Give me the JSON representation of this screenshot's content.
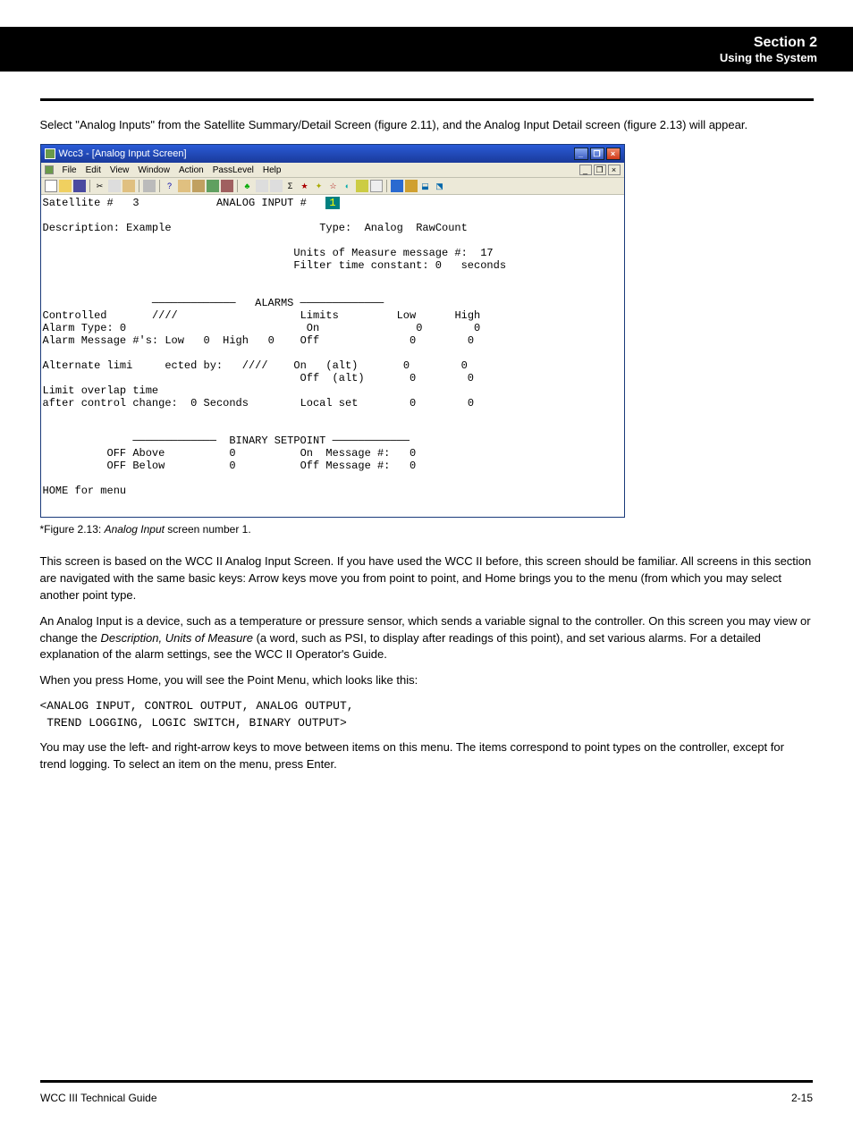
{
  "header": {
    "section_title": "Section 2",
    "section_subtitle": "Using the System"
  },
  "intro": "Select \"Analog Inputs\" from the Satellite Summary/Detail Screen (figure 2.11), and the Analog Input Detail screen (figure 2.13) will appear.",
  "window": {
    "title": "Wcc3 - [Analog Input Screen]",
    "menu": [
      "File",
      "Edit",
      "View",
      "Window",
      "Action",
      "PassLevel",
      "Help"
    ],
    "mdi_controls": {
      "min": "_",
      "restore": "❐",
      "close": "×"
    },
    "win_controls": {
      "min": "_",
      "max": "❐",
      "close": "×"
    },
    "client": {
      "satellite_label": "Satellite #",
      "satellite_num": "3",
      "analog_input_label": "ANALOG INPUT #",
      "analog_input_num": "1",
      "description_label": "Description:",
      "description_value": "Example",
      "type_label": "Type:",
      "type_value": "Analog  RawCount",
      "units_label": "Units of Measure message #:",
      "units_value": "17",
      "filter_label": "Filter time constant:",
      "filter_value": "0",
      "filter_units": "seconds",
      "alarms_header": "ALARMS",
      "controlled_label": "Controlled",
      "controlled_value": "////",
      "limits_label": "Limits",
      "low_label": "Low",
      "high_label": "High",
      "alarm_type_label": "Alarm Type:",
      "alarm_type_value": "0",
      "on_label": "On",
      "off_label": "Off",
      "alarm_msg_label": "Alarm Message #'s: Low",
      "alarm_msg_low": "0",
      "alarm_msg_high_label": "High",
      "alarm_msg_high": "0",
      "on_low": "0",
      "on_high": "0",
      "off_low": "0",
      "off_high": "0",
      "alt_label": "Alternate limi     ected by:",
      "alt_value": "////",
      "alt_on_label": "On   (alt)",
      "alt_on_low": "0",
      "alt_on_high": "0",
      "alt_off_label": "Off  (alt)",
      "alt_off_low": "0",
      "alt_off_high": "0",
      "overlap_label1": "Limit overlap time",
      "overlap_label2": "after control change:",
      "overlap_value": "0",
      "overlap_units": "Seconds",
      "localset_label": "Local set",
      "localset_low": "0",
      "localset_high": "0",
      "binary_header": "BINARY SETPOINT",
      "off_above_label": "OFF Above",
      "off_above_value": "0",
      "on_msg_label": "On  Message #:",
      "on_msg_value": "0",
      "off_below_label": "OFF Below",
      "off_below_value": "0",
      "off_msg_label": "Off Message #:",
      "off_msg_value": "0",
      "home_label": "HOME for menu"
    }
  },
  "caption": {
    "fig_label": "*Figure 2.13:",
    "fig_name": "Analog Input",
    "fig_rest": " screen number 1."
  },
  "paras": {
    "p1": "This screen is based on the WCC II Analog Input Screen. If you have used the WCC II before, this screen should be familiar. All screens in this section are navigated with the same basic keys: Arrow keys move you from point to point, and Home brings you to the menu (from which you may select another point type.",
    "p2_a": "An Analog Input is a device, such as a temperature or pressure sensor, which sends a variable signal to the controller. On this screen you may view or change the ",
    "p2_b": " (a word, such as PSI, to display after readings of this point), and set various alarms. For a detailed explanation of the alarm settings, see the WCC II Operator's Guide.",
    "desc_em": "Description, Units of Measure",
    "p3": "When you press Home, you will see the Point Menu, which looks like this:",
    "mono": "<ANALOG INPUT, CONTROL OUTPUT, ANALOG OUTPUT,\n TREND LOGGING, LOGIC SWITCH, BINARY OUTPUT>",
    "p4": "You may use the left- and right-arrow keys to move between items on this menu. The items correspond to point types on the controller, except for trend logging. To select an item on the menu, press Enter."
  },
  "footer": {
    "left": "WCC III Technical Guide",
    "right": "2-15"
  }
}
